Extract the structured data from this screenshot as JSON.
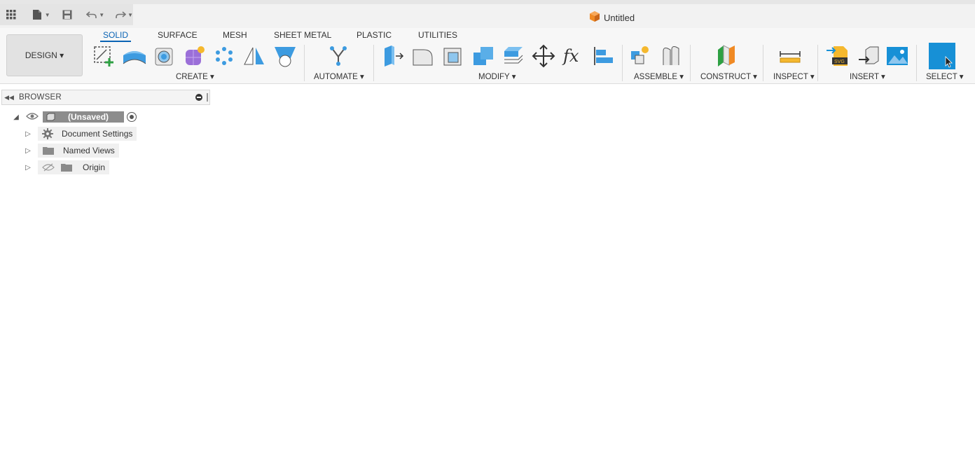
{
  "window": {
    "title": "Untitled"
  },
  "quick_access": {
    "icons": [
      "grid-icon",
      "file-icon",
      "save-icon",
      "undo-icon",
      "redo-icon"
    ]
  },
  "workspace": {
    "label": "DESIGN ▾"
  },
  "tabs": [
    {
      "label": "SOLID",
      "active": true
    },
    {
      "label": "SURFACE"
    },
    {
      "label": "MESH"
    },
    {
      "label": "SHEET METAL"
    },
    {
      "label": "PLASTIC"
    },
    {
      "label": "UTILITIES"
    }
  ],
  "groups": {
    "create": "CREATE ▾",
    "automate": "AUTOMATE ▾",
    "modify": "MODIFY ▾",
    "assemble": "ASSEMBLE ▾",
    "construct": "CONSTRUCT ▾",
    "inspect": "INSPECT ▾",
    "insert": "INSERT ▾",
    "select": "SELECT ▾"
  },
  "browser": {
    "title": "BROWSER",
    "root": "(Unsaved)",
    "items": [
      {
        "label": "Document Settings",
        "icon": "gear-icon"
      },
      {
        "label": "Named Views",
        "icon": "folder-icon"
      },
      {
        "label": "Origin",
        "icon": "folder-icon"
      }
    ]
  },
  "colors": {
    "accent": "#0a64b4",
    "select_blue": "#1790d6",
    "tool_blue": "#3d9be0"
  }
}
